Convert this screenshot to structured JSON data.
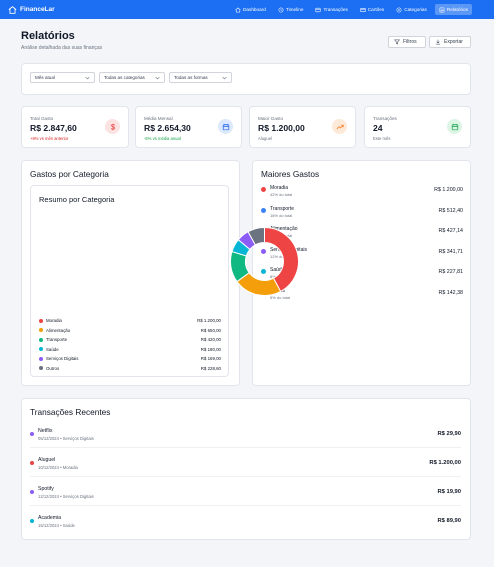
{
  "app": {
    "brand": "FinanceLar",
    "nav": [
      {
        "label": "Dashboard",
        "icon": "home-icon",
        "active": false
      },
      {
        "label": "Timeline",
        "icon": "timeline-icon",
        "active": false
      },
      {
        "label": "Transações",
        "icon": "transactions-icon",
        "active": false
      },
      {
        "label": "Cartões",
        "icon": "card-icon",
        "active": false
      },
      {
        "label": "Categorias",
        "icon": "categories-icon",
        "active": false
      },
      {
        "label": "Relatórios",
        "icon": "reports-icon",
        "active": true
      }
    ]
  },
  "header": {
    "title": "Relatórios",
    "subtitle": "Análise detalhada das suas finanças",
    "filters_button": "Filtros",
    "export_button": "Exportar"
  },
  "filters": {
    "period": "Mês atual",
    "category": "Todas as categorias",
    "payment": "Todas as formas"
  },
  "stats": [
    {
      "label": "Total Gasto",
      "value": "R$ 2.847,60",
      "note": "+8% vs mês anterior",
      "note_color": "#dc2626",
      "icon": "dollar-icon",
      "icon_color": "#ef4444",
      "icon_bg": "#fde2e2"
    },
    {
      "label": "Média Mensal",
      "value": "R$ 2.654,30",
      "note": "-5% vs média anual",
      "note_color": "#16a34a",
      "icon": "calendar-icon",
      "icon_color": "#2563eb",
      "icon_bg": "#dbe8fd"
    },
    {
      "label": "Maior Gasto",
      "value": "R$ 1.200,00",
      "note": "Aluguel",
      "note_color": "#6b7280",
      "icon": "trending-up-icon",
      "icon_color": "#f97316",
      "icon_bg": "#fde9d7"
    },
    {
      "label": "Transações",
      "value": "24",
      "note": "Este mês",
      "note_color": "#6b7280",
      "icon": "calendar-check-icon",
      "icon_color": "#16a34a",
      "icon_bg": "#dcf5e4"
    }
  ],
  "category_section": {
    "title": "Gastos por Categoria",
    "summary_title": "Resumo por Categoria",
    "legend": [
      {
        "name": "Moradia",
        "value": "R$ 1.200,00",
        "color": "#ef4444"
      },
      {
        "name": "Alimentação",
        "value": "R$ 650,00",
        "color": "#f59e0b"
      },
      {
        "name": "Transporte",
        "value": "R$ 420,00",
        "color": "#10b981"
      },
      {
        "name": "Saúde",
        "value": "R$ 180,00",
        "color": "#06b6d4"
      },
      {
        "name": "Serviços Digitais",
        "value": "R$ 169,00",
        "color": "#8b5cf6"
      },
      {
        "name": "Outros",
        "value": "R$ 228,60",
        "color": "#6b7280"
      }
    ]
  },
  "top_section": {
    "title": "Maiores Gastos",
    "items": [
      {
        "name": "Moradia",
        "pct": "42% do total",
        "value": "R$ 1.200,00",
        "color": "#ef4444"
      },
      {
        "name": "Transporte",
        "pct": "18% do total",
        "value": "R$ 512,40",
        "color": "#3b82f6"
      },
      {
        "name": "Alimentação",
        "pct": "15% do total",
        "value": "R$ 427,14",
        "color": "#f59e0b"
      },
      {
        "name": "Serviços Digitais",
        "pct": "12% do total",
        "value": "R$ 341,71",
        "color": "#8b5cf6"
      },
      {
        "name": "Saúde",
        "pct": "8% do total",
        "value": "R$ 227,81",
        "color": "#06b6d4"
      },
      {
        "name": "Outros",
        "pct": "5% do total",
        "value": "R$ 142,38",
        "color": "#6b7280"
      }
    ]
  },
  "chart_data": {
    "type": "pie",
    "categories": [
      "Moradia",
      "Alimentação",
      "Transporte",
      "Saúde",
      "Serviços Digitais",
      "Outros"
    ],
    "values": [
      1200,
      650,
      420,
      180,
      169,
      228.6
    ],
    "colors": [
      "#ef4444",
      "#f59e0b",
      "#10b981",
      "#06b6d4",
      "#8b5cf6",
      "#6b7280"
    ],
    "title": "",
    "donut": true
  },
  "recent": {
    "title": "Transações Recentes",
    "items": [
      {
        "name": "Netflix",
        "meta": "05/12/2024 • Serviços Digitais",
        "value": "R$ 29,90",
        "color": "#8b5cf6"
      },
      {
        "name": "Aluguel",
        "meta": "10/12/2024 • Moradia",
        "value": "R$ 1.200,00",
        "color": "#ef4444"
      },
      {
        "name": "Spotify",
        "meta": "12/12/2024 • Serviços Digitais",
        "value": "R$ 19,90",
        "color": "#8b5cf6"
      },
      {
        "name": "Academia",
        "meta": "15/12/2024 • Saúde",
        "value": "R$ 89,90",
        "color": "#06b6d4"
      }
    ]
  }
}
